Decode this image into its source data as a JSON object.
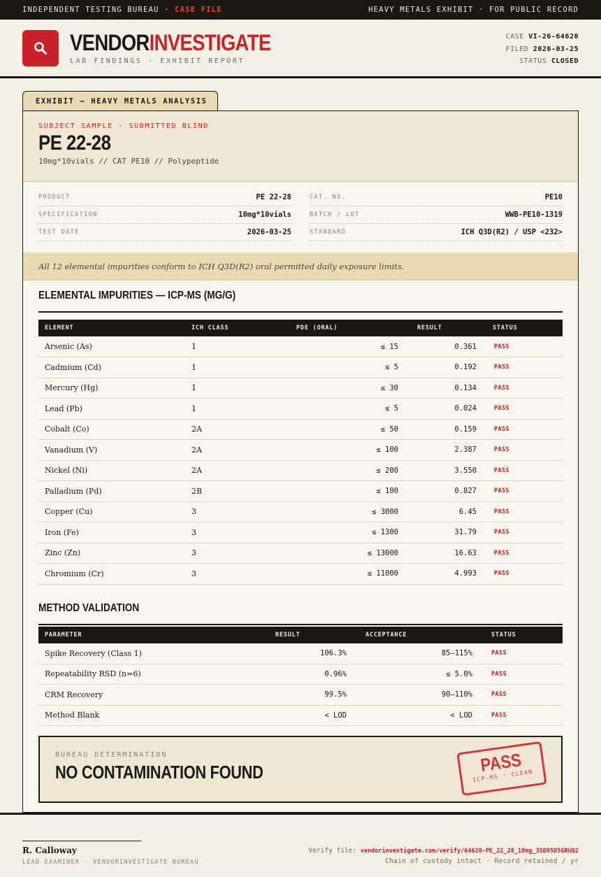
{
  "topbar": {
    "left_text": "INDEPENDENT TESTING BUREAU · ",
    "left_accent": "CASE FILE",
    "right_text": "HEAVY METALS EXHIBIT · FOR PUBLIC RECORD"
  },
  "brand": {
    "name_part1": "VENDOR",
    "name_part2": "INVESTIGATE",
    "subtitle": "LAB FINDINGS · EXHIBIT REPORT",
    "icon": "magnifier-icon",
    "accent_color": "#c8232b"
  },
  "case": {
    "case_label": "CASE",
    "case_value": "VI-26-64620",
    "filed_label": "FILED",
    "filed_value": "2026-03-25",
    "status_label": "STATUS",
    "status_value": "CLOSED"
  },
  "exhibit_tab": "EXHIBIT — HEAVY METALS ANALYSIS",
  "subject": {
    "eyebrow": "SUBJECT SAMPLE · SUBMITTED BLIND",
    "title": "PE 22-28",
    "specline": "10mg*10vials  //  CAT PE10  //  Polypeptide"
  },
  "info_left": [
    {
      "label": "PRODUCT",
      "value": "PE 22-28"
    },
    {
      "label": "SPECIFICATION",
      "value": "10mg*10vials"
    },
    {
      "label": "TEST DATE",
      "value": "2026-03-25"
    }
  ],
  "info_right": [
    {
      "label": "CAT. NO.",
      "value": "PE10"
    },
    {
      "label": "BATCH / LOT",
      "value": "WWB-PE10-1319"
    },
    {
      "label": "STANDARD",
      "value": "ICH Q3D(R2) / USP <232>"
    }
  ],
  "summary": "All 12 elemental impurities conform to ICH Q3D(R2) oral permitted daily exposure limits.",
  "impurities": {
    "title": "ELEMENTAL IMPURITIES — ICP-MS (ΜG/G)",
    "headers": [
      "ELEMENT",
      "ICH CLASS",
      "PDE (ORAL)",
      "RESULT",
      "STATUS"
    ],
    "rows": [
      {
        "element": "Arsenic (As)",
        "class": "1",
        "pde": "≤ 15",
        "result": "0.361",
        "status": "PASS"
      },
      {
        "element": "Cadmium (Cd)",
        "class": "1",
        "pde": "≤ 5",
        "result": "0.192",
        "status": "PASS"
      },
      {
        "element": "Mercury (Hg)",
        "class": "1",
        "pde": "≤ 30",
        "result": "0.134",
        "status": "PASS"
      },
      {
        "element": "Lead (Pb)",
        "class": "1",
        "pde": "≤ 5",
        "result": "0.024",
        "status": "PASS"
      },
      {
        "element": "Cobalt (Co)",
        "class": "2A",
        "pde": "≤ 50",
        "result": "0.159",
        "status": "PASS"
      },
      {
        "element": "Vanadium (V)",
        "class": "2A",
        "pde": "≤ 100",
        "result": "2.387",
        "status": "PASS"
      },
      {
        "element": "Nickel (Ni)",
        "class": "2A",
        "pde": "≤ 200",
        "result": "3.550",
        "status": "PASS"
      },
      {
        "element": "Palladium (Pd)",
        "class": "2B",
        "pde": "≤ 100",
        "result": "0.827",
        "status": "PASS"
      },
      {
        "element": "Copper (Cu)",
        "class": "3",
        "pde": "≤ 3000",
        "result": "6.45",
        "status": "PASS"
      },
      {
        "element": "Iron (Fe)",
        "class": "3",
        "pde": "≤ 1300",
        "result": "31.79",
        "status": "PASS"
      },
      {
        "element": "Zinc (Zn)",
        "class": "3",
        "pde": "≤ 13000",
        "result": "16.63",
        "status": "PASS"
      },
      {
        "element": "Chromium (Cr)",
        "class": "3",
        "pde": "≤ 11000",
        "result": "4.993",
        "status": "PASS"
      }
    ]
  },
  "validation": {
    "title": "METHOD VALIDATION",
    "headers": [
      "PARAMETER",
      "RESULT",
      "ACCEPTANCE",
      "STATUS"
    ],
    "rows": [
      {
        "parameter": "Spike Recovery (Class 1)",
        "result": "106.3%",
        "acceptance": "85–115%",
        "status": "PASS"
      },
      {
        "parameter": "Repeatability RSD (n=6)",
        "result": "0.96%",
        "acceptance": "≤ 5.0%",
        "status": "PASS"
      },
      {
        "parameter": "CRM Recovery",
        "result": "99.5%",
        "acceptance": "90–110%",
        "status": "PASS"
      },
      {
        "parameter": "Method Blank",
        "result": "< LOD",
        "acceptance": "< LOD",
        "status": "PASS"
      }
    ]
  },
  "determination": {
    "eyebrow": "BUREAU DETERMINATION",
    "verdict": "NO CONTAMINATION FOUND",
    "stamp_big": "PASS",
    "stamp_small": "ICP-MS · CLEAN"
  },
  "footer": {
    "signer_name": "R. Calloway",
    "signer_role": "LEAD EXAMINER · VENDORINVESTIGATE BUREAU",
    "verify_label": "Verify file: ",
    "verify_url": "vendorinvestigate.com/verify/64620-PE_22_28_10mg_3SD95D5GRUQ2",
    "custody": "Chain of custody intact · Record retained / yr"
  }
}
